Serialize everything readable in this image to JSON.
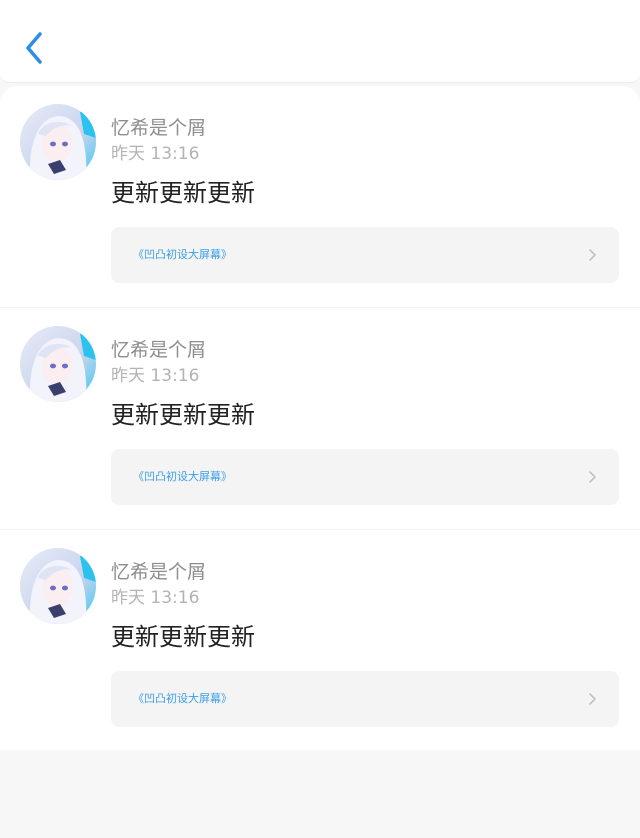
{
  "header": {
    "back_icon": "chevron-left-icon",
    "accent_color": "#2a8ee8"
  },
  "colors": {
    "link_text": "#3c9ee6",
    "username": "#8e8e8e",
    "timestamp": "#b3b3b3",
    "content": "#222222",
    "card_bg": "#f4f4f5"
  },
  "posts": [
    {
      "username": "忆希是个屑",
      "timestamp": "昨天 13:16",
      "content": "更新更新更新",
      "link_text": "《凹凸初设大屏幕》",
      "link_icon": "chevron-right-icon"
    },
    {
      "username": "忆希是个屑",
      "timestamp": "昨天 13:16",
      "content": "更新更新更新",
      "link_text": "《凹凸初设大屏幕》",
      "link_icon": "chevron-right-icon"
    },
    {
      "username": "忆希是个屑",
      "timestamp": "昨天 13:16",
      "content": "更新更新更新",
      "link_text": "《凹凸初设大屏幕》",
      "link_icon": "chevron-right-icon"
    }
  ]
}
